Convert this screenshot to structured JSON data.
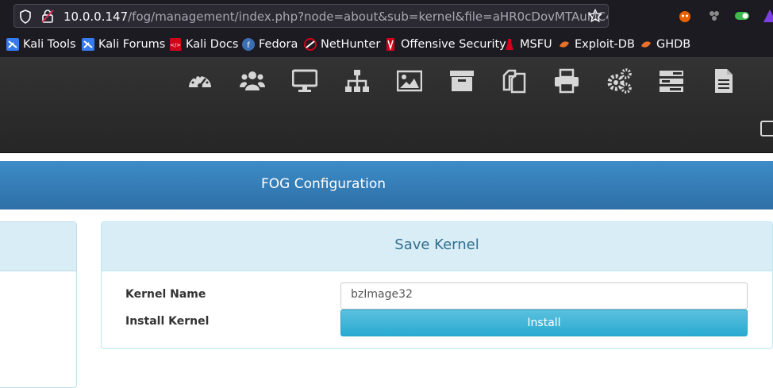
{
  "browser": {
    "url_host": "10.0.0.147",
    "url_path": "/fog/management/index.php?node=about&sub=kernel&file=aHR0cDovMTAuMC4wLjE"
  },
  "bookmarks": [
    {
      "label": "Kali Tools",
      "icon": "kali-icon"
    },
    {
      "label": "Kali Forums",
      "icon": "kali-icon"
    },
    {
      "label": "Kali Docs",
      "icon": "kali-docs-icon"
    },
    {
      "label": "Fedora",
      "icon": "fedora-icon"
    },
    {
      "label": "NetHunter",
      "icon": "nethunter-icon"
    },
    {
      "label": "Offensive Security",
      "icon": "offsec-icon"
    },
    {
      "label": "MSFU",
      "icon": "msfu-icon"
    },
    {
      "label": "Exploit-DB",
      "icon": "exploitdb-icon"
    },
    {
      "label": "GHDB",
      "icon": "exploitdb-icon"
    }
  ],
  "nav_icons": [
    "dashboard-icon",
    "users-icon",
    "hosts-icon",
    "groups-icon",
    "images-icon",
    "storage-icon",
    "snapins-icon",
    "printers-icon",
    "service-config-icon",
    "tasks-icon",
    "reports-icon"
  ],
  "section": {
    "title": "FOG Configuration"
  },
  "panel": {
    "title": "Save Kernel",
    "kernel_name_label": "Kernel Name",
    "kernel_name_value": "bzImage32",
    "install_label": "Install Kernel",
    "install_button": "Install"
  },
  "colors": {
    "browser_chrome": "#1c1b22",
    "fog_header": "#2b2b2b",
    "title_bar": "#3580ba",
    "panel_heading": "#d9edf7",
    "button": "#5bc0de"
  }
}
